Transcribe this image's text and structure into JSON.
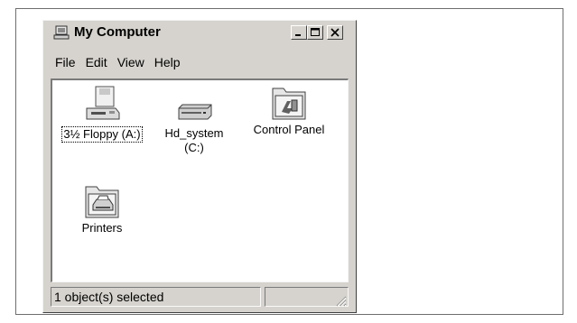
{
  "window": {
    "title": "My Computer",
    "icon": "my-computer-icon",
    "controls": [
      "minimize",
      "maximize",
      "close"
    ]
  },
  "menu": [
    "File",
    "Edit",
    "View",
    "Help"
  ],
  "items": [
    {
      "label": "3½ Floppy (A:)",
      "icon": "floppy-drive-icon",
      "selected": true
    },
    {
      "label": "Hd_system (C:)",
      "icon": "hard-drive-icon",
      "selected": false
    },
    {
      "label": "Control Panel",
      "icon": "control-panel-folder-icon",
      "selected": false
    },
    {
      "label": "Printers",
      "icon": "printers-folder-icon",
      "selected": false
    }
  ],
  "status": {
    "text": "1 object(s) selected"
  }
}
